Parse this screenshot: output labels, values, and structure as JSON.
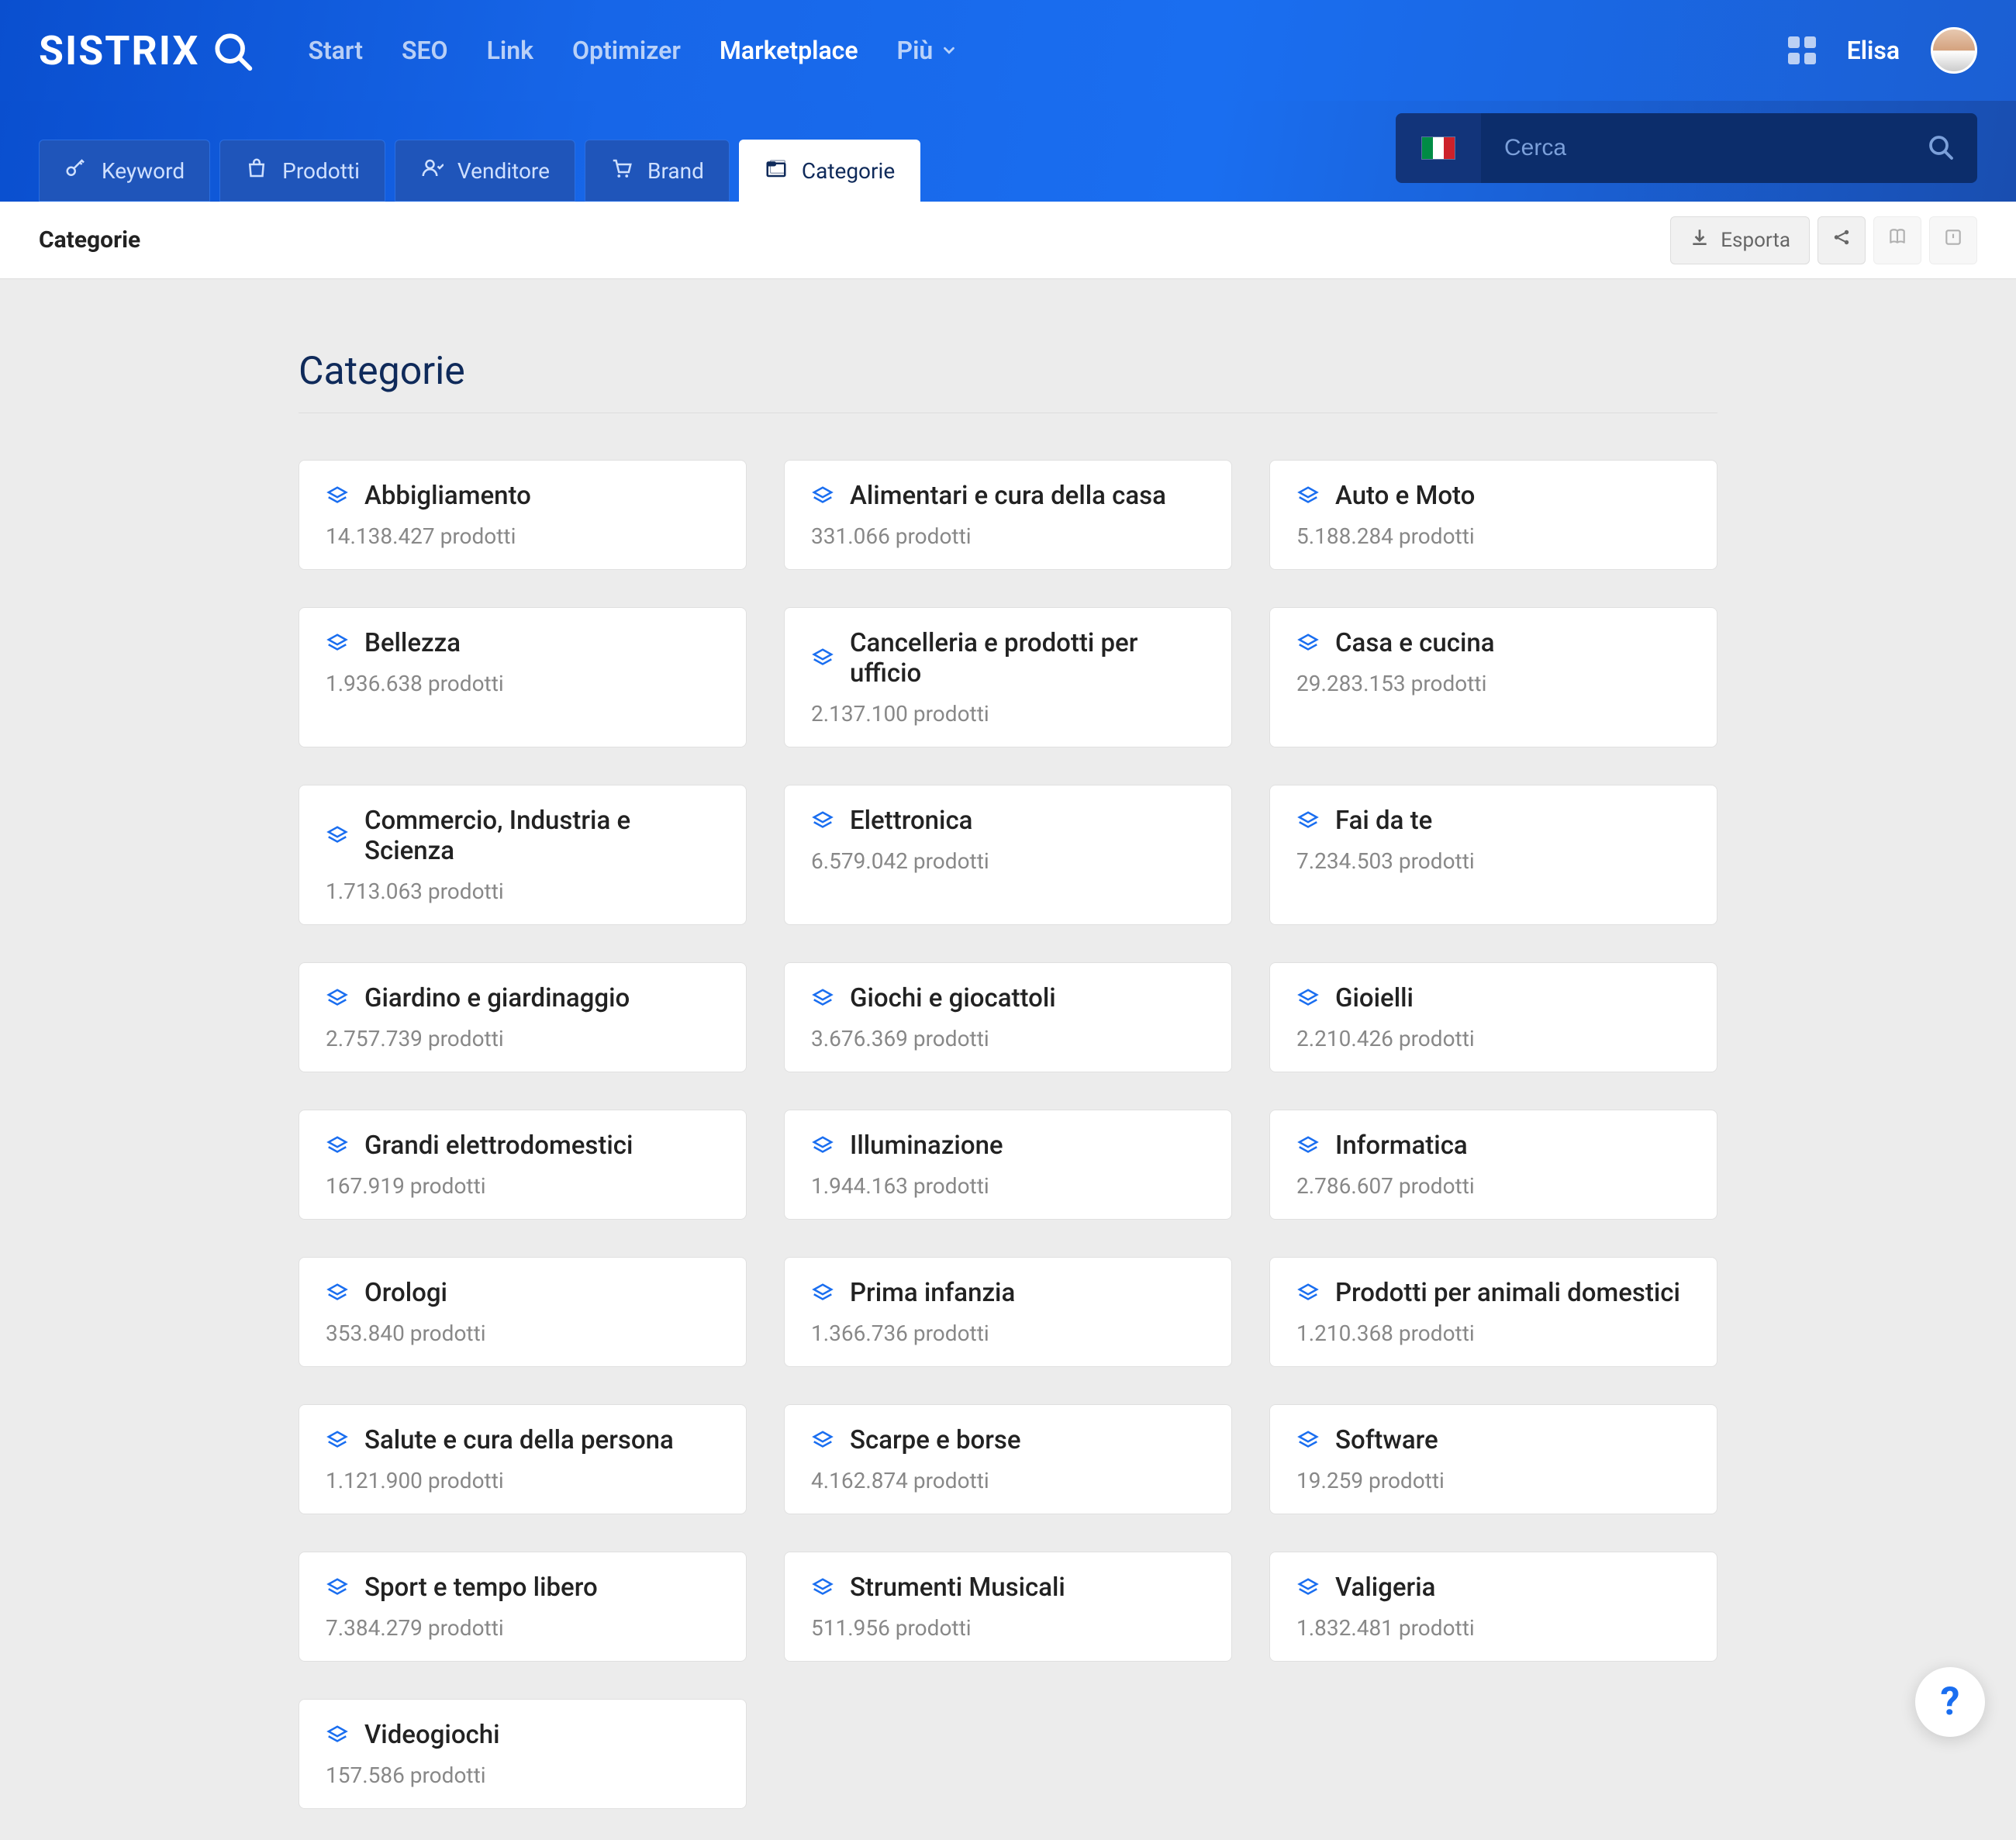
{
  "brand": "SISTRIX",
  "nav": [
    {
      "key": "start",
      "label": "Start"
    },
    {
      "key": "seo",
      "label": "SEO"
    },
    {
      "key": "link",
      "label": "Link"
    },
    {
      "key": "optimizer",
      "label": "Optimizer"
    },
    {
      "key": "marketplace",
      "label": "Marketplace",
      "active": true
    },
    {
      "key": "more",
      "label": "Più",
      "dropdown": true
    }
  ],
  "user": {
    "name": "Elisa"
  },
  "tabs": [
    {
      "key": "keyword",
      "icon": "key-icon",
      "label": "Keyword"
    },
    {
      "key": "prodotti",
      "icon": "bag-icon",
      "label": "Prodotti"
    },
    {
      "key": "venditore",
      "icon": "person-icon",
      "label": "Venditore"
    },
    {
      "key": "brand",
      "icon": "cart-icon",
      "label": "Brand"
    },
    {
      "key": "categorie",
      "icon": "folder-icon",
      "label": "Categorie",
      "active": true
    }
  ],
  "search": {
    "placeholder": "Cerca",
    "flag": "it"
  },
  "page": {
    "title": "Categorie",
    "section_title": "Categorie"
  },
  "toolbar": {
    "export": "Esporta"
  },
  "product_word": "prodotti",
  "categories": [
    {
      "name": "Abbigliamento",
      "count": "14.138.427"
    },
    {
      "name": "Alimentari e cura della casa",
      "count": "331.066"
    },
    {
      "name": "Auto e Moto",
      "count": "5.188.284"
    },
    {
      "name": "Bellezza",
      "count": "1.936.638"
    },
    {
      "name": "Cancelleria e prodotti per ufficio",
      "count": "2.137.100"
    },
    {
      "name": "Casa e cucina",
      "count": "29.283.153"
    },
    {
      "name": "Commercio, Industria e Scienza",
      "count": "1.713.063"
    },
    {
      "name": "Elettronica",
      "count": "6.579.042"
    },
    {
      "name": "Fai da te",
      "count": "7.234.503"
    },
    {
      "name": "Giardino e giardinaggio",
      "count": "2.757.739"
    },
    {
      "name": "Giochi e giocattoli",
      "count": "3.676.369"
    },
    {
      "name": "Gioielli",
      "count": "2.210.426"
    },
    {
      "name": "Grandi elettrodomestici",
      "count": "167.919"
    },
    {
      "name": "Illuminazione",
      "count": "1.944.163"
    },
    {
      "name": "Informatica",
      "count": "2.786.607"
    },
    {
      "name": "Orologi",
      "count": "353.840"
    },
    {
      "name": "Prima infanzia",
      "count": "1.366.736"
    },
    {
      "name": "Prodotti per animali domestici",
      "count": "1.210.368"
    },
    {
      "name": "Salute e cura della persona",
      "count": "1.121.900"
    },
    {
      "name": "Scarpe e borse",
      "count": "4.162.874"
    },
    {
      "name": "Software",
      "count": "19.259"
    },
    {
      "name": "Sport e tempo libero",
      "count": "7.384.279"
    },
    {
      "name": "Strumenti Musicali",
      "count": "511.956"
    },
    {
      "name": "Valigeria",
      "count": "1.832.481"
    },
    {
      "name": "Videogiochi",
      "count": "157.586"
    }
  ],
  "help_label": "?"
}
